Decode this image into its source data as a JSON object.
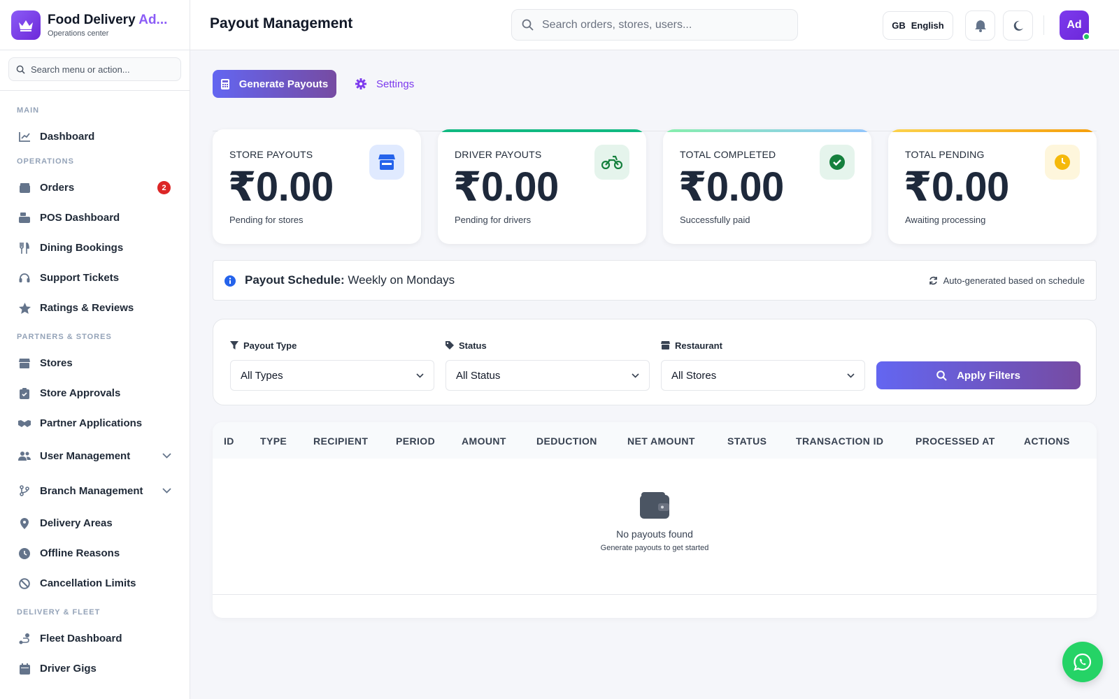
{
  "brand": {
    "name_main": "Food Delivery ",
    "name_accent": "Ad...",
    "subtitle": "Operations center",
    "icon": "crown-icon"
  },
  "sidebar": {
    "search_placeholder": "Search menu or action...",
    "sections": {
      "main": "MAIN",
      "operations": "OPERATIONS",
      "partners": "PARTNERS & STORES",
      "delivery": "DELIVERY & FLEET"
    },
    "items": {
      "dashboard": "Dashboard",
      "orders": "Orders",
      "orders_badge": "2",
      "pos": "POS Dashboard",
      "dining": "Dining Bookings",
      "support": "Support Tickets",
      "ratings": "Ratings & Reviews",
      "stores": "Stores",
      "store_approvals": "Store Approvals",
      "partner_apps": "Partner Applications",
      "user_mgmt": "User Management",
      "branch_mgmt": "Branch Management",
      "delivery_areas": "Delivery Areas",
      "offline_reasons": "Offline Reasons",
      "cancel_limits": "Cancellation Limits",
      "fleet": "Fleet Dashboard",
      "driver_gigs": "Driver Gigs"
    }
  },
  "header": {
    "title": "Payout Management",
    "search_placeholder": "Search orders, stores, users...",
    "lang_code": "GB",
    "lang_label": "English",
    "avatar": "Ad"
  },
  "actions": {
    "generate": "Generate Payouts",
    "settings": "Settings"
  },
  "stats": {
    "store": {
      "label": "STORE PAYOUTS",
      "value": "₹0.00",
      "sub": "Pending for stores",
      "icon": "store-icon"
    },
    "driver": {
      "label": "DRIVER PAYOUTS",
      "value": "₹0.00",
      "sub": "Pending for drivers",
      "icon": "motorcycle-icon",
      "accent": "#10b981"
    },
    "completed": {
      "label": "TOTAL COMPLETED",
      "value": "₹0.00",
      "sub": "Successfully paid",
      "icon": "check-circle-icon"
    },
    "pending": {
      "label": "TOTAL PENDING",
      "value": "₹0.00",
      "sub": "Awaiting processing",
      "icon": "clock-icon",
      "accent": "#f59e0b"
    }
  },
  "schedule": {
    "label": "Payout Schedule:",
    "value": "Weekly on Mondays",
    "note": "Auto-generated based on schedule"
  },
  "filters": {
    "payout_type": {
      "label": "Payout Type",
      "value": "All Types"
    },
    "status": {
      "label": "Status",
      "value": "All Status"
    },
    "restaurant": {
      "label": "Restaurant",
      "value": "All Stores"
    },
    "apply": "Apply Filters"
  },
  "table": {
    "columns": [
      "ID",
      "TYPE",
      "RECIPIENT",
      "PERIOD",
      "AMOUNT",
      "DEDUCTION",
      "NET AMOUNT",
      "STATUS",
      "TRANSACTION ID",
      "PROCESSED AT",
      "ACTIONS"
    ],
    "empty_title": "No payouts found",
    "empty_sub": "Generate payouts to get started"
  },
  "colors": {
    "primary": "#6366f1",
    "accent_purple": "#764ba2",
    "badge": "#dc2626",
    "whatsapp": "#25d366"
  }
}
